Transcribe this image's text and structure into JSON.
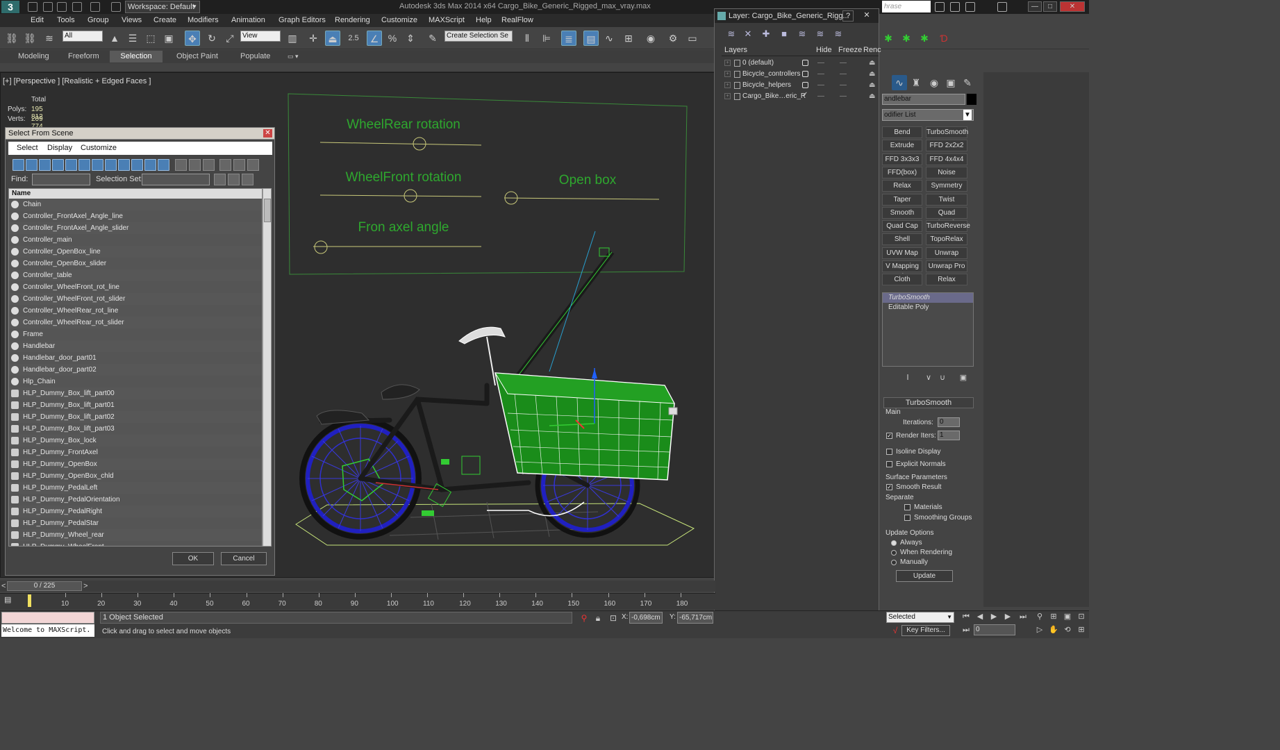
{
  "titlebar": {
    "workspace": "Workspace: Default",
    "title": "Autodesk 3ds Max  2014 x64    Cargo_Bike_Generic_Rigged_max_vray.max",
    "search_placeholder": "hrase",
    "min": "—",
    "max": "□",
    "close": "✕"
  },
  "menu": [
    "Edit",
    "Tools",
    "Group",
    "Views",
    "Create",
    "Modifiers",
    "Animation",
    "Graph Editors",
    "Rendering",
    "Customize",
    "MAXScript",
    "Help",
    "RealFlow"
  ],
  "toolbar": {
    "filter_select": "All",
    "view_select": "View",
    "angle_snap": "2.5",
    "named_selection": "Create Selection Se"
  },
  "ribbon": {
    "tabs": [
      "Modeling",
      "Freeform",
      "Selection",
      "Object Paint",
      "Populate"
    ],
    "active": "Selection"
  },
  "viewport": {
    "label": "[+] [Perspective ] [Realistic + Edged Faces ]",
    "stats_header": "Total",
    "polys_label": "Polys:",
    "polys_value": "195 812",
    "verts_label": "Verts:",
    "verts_value": "209 774",
    "controller_titles": {
      "wheel_rear": "WheelRear rotation",
      "wheel_front": "WheelFront rotation",
      "open_box": "Open box",
      "front_axel": "Fron axel angle"
    },
    "accent_green": "#3aa63a",
    "box_green": "#1a8c1a",
    "wheel_blue": "#2020c0"
  },
  "select_from_scene": {
    "title": "Select From Scene",
    "close": "✕",
    "menu": [
      "Select",
      "Display",
      "Customize"
    ],
    "find_label": "Find:",
    "find_value": "",
    "selection_set_label": "Selection Set:",
    "selection_set_value": "",
    "column_name": "Name",
    "items": [
      {
        "name": "Chain",
        "type": "geo"
      },
      {
        "name": "Controller_FrontAxel_Angle_line",
        "type": "shape"
      },
      {
        "name": "Controller_FrontAxel_Angle_slider",
        "type": "shape"
      },
      {
        "name": "Controller_main",
        "type": "shape"
      },
      {
        "name": "Controller_OpenBox_line",
        "type": "shape"
      },
      {
        "name": "Controller_OpenBox_slider",
        "type": "shape"
      },
      {
        "name": "Controller_table",
        "type": "shape"
      },
      {
        "name": "Controller_WheelFront_rot_line",
        "type": "shape"
      },
      {
        "name": "Controller_WheelFront_rot_slider",
        "type": "shape"
      },
      {
        "name": "Controller_WheelRear_rot_line",
        "type": "shape"
      },
      {
        "name": "Controller_WheelRear_rot_slider",
        "type": "shape"
      },
      {
        "name": "Frame",
        "type": "geo"
      },
      {
        "name": "Handlebar",
        "type": "geo"
      },
      {
        "name": "Handlebar_door_part01",
        "type": "geo"
      },
      {
        "name": "Handlebar_door_part02",
        "type": "geo"
      },
      {
        "name": "Hlp_Chain",
        "type": "shape"
      },
      {
        "name": "HLP_Dummy_Box_lift_part00",
        "type": "helper"
      },
      {
        "name": "HLP_Dummy_Box_lift_part01",
        "type": "helper"
      },
      {
        "name": "HLP_Dummy_Box_lift_part02",
        "type": "helper"
      },
      {
        "name": "HLP_Dummy_Box_lift_part03",
        "type": "helper"
      },
      {
        "name": "HLP_Dummy_Box_lock",
        "type": "helper"
      },
      {
        "name": "HLP_Dummy_FrontAxel",
        "type": "helper"
      },
      {
        "name": "HLP_Dummy_OpenBox",
        "type": "helper"
      },
      {
        "name": "HLP_Dummy_OpenBox_chld",
        "type": "helper"
      },
      {
        "name": "HLP_Dummy_PedalLeft",
        "type": "helper"
      },
      {
        "name": "HLP_Dummy_PedalOrientation",
        "type": "helper"
      },
      {
        "name": "HLP_Dummy_PedalRight",
        "type": "helper"
      },
      {
        "name": "HLP_Dummy_PedalStar",
        "type": "helper"
      },
      {
        "name": "HLP_Dummy_Wheel_rear",
        "type": "helper"
      },
      {
        "name": "HLP_Dummy_WheelFront",
        "type": "helper"
      }
    ],
    "ok": "OK",
    "cancel": "Cancel"
  },
  "layer_dialog": {
    "title": "Layer: Cargo_Bike_Generic_Rigg...",
    "help": "?",
    "close": "✕",
    "col_layers": "Layers",
    "col_hide": "Hide",
    "col_freeze": "Freeze",
    "col_render": "Renc",
    "layers": [
      {
        "name": "0 (default)",
        "current": false
      },
      {
        "name": "Bicycle_controllers",
        "current": false
      },
      {
        "name": "Bicycle_helpers",
        "current": false
      },
      {
        "name": "Cargo_Bike…eric_R",
        "current": true
      }
    ]
  },
  "command_panel": {
    "object_name": "andlebar",
    "modifier_list": "odifier List",
    "modifiers": [
      "Bend",
      "TurboSmooth",
      "Extrude",
      "FFD 2x2x2",
      "FFD 3x3x3",
      "FFD 4x4x4",
      "FFD(box)",
      "Noise",
      "Relax",
      "Symmetry",
      "Taper",
      "Twist",
      "Smooth",
      "Quad Chamfer",
      "Quad Cap Pro",
      "TurboReverse",
      "Shell",
      "TopoRelax",
      "UVW Map",
      "Unwrap UVW",
      "V Mapping Cle",
      "Unwrap Pro",
      "Cloth",
      "Relax"
    ],
    "stack": [
      "TurboSmooth",
      "Editable Poly"
    ],
    "rollout_title": "TurboSmooth",
    "main": "Main",
    "iterations_label": "Iterations:",
    "iterations_value": "0",
    "render_iters_label": "Render Iters:",
    "render_iters_value": "1",
    "isoline": "Isoline Display",
    "explicit": "Explicit Normals",
    "surface_params": "Surface Parameters",
    "smooth_result": "Smooth Result",
    "separate": "Separate",
    "materials": "Materials",
    "smoothing_groups": "Smoothing Groups",
    "update_options": "Update Options",
    "always": "Always",
    "when_rendering": "When Rendering",
    "manually": "Manually",
    "update": "Update"
  },
  "timeline": {
    "frame": "0 / 225",
    "ticks": [
      "10",
      "20",
      "30",
      "40",
      "50",
      "60",
      "70",
      "80",
      "90",
      "100",
      "110",
      "120",
      "130",
      "140",
      "150",
      "160",
      "170",
      "180"
    ]
  },
  "status": {
    "welcome": "Welcome to MAXScript.",
    "selected": "1 Object Selected",
    "prompt": "Click and drag to select and move objects",
    "x_label": "X:",
    "x_value": "-0,698cm",
    "y_label": "Y:",
    "y_value": "-65,717cm",
    "selected_dropdown": "Selected",
    "key_filters": "Key Filters...",
    "frame_value": "0"
  }
}
